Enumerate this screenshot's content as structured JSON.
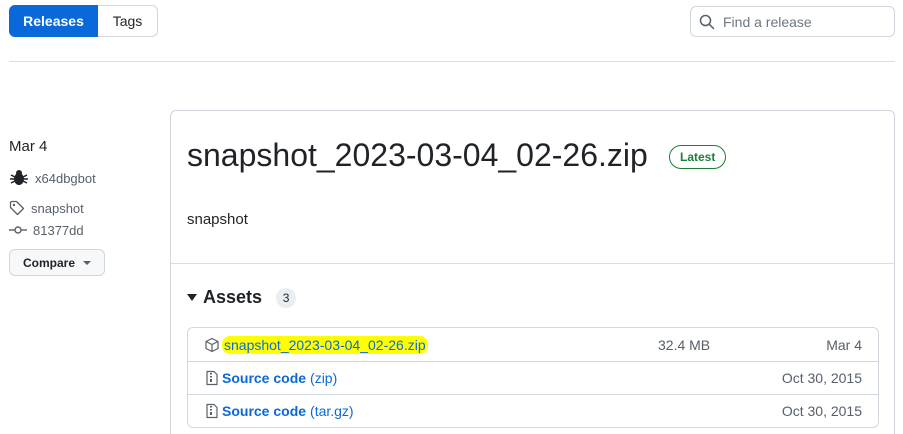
{
  "tabs": {
    "releases": "Releases",
    "tags": "Tags"
  },
  "search": {
    "placeholder": "Find a release"
  },
  "meta": {
    "date": "Mar 4",
    "author": "x64dbgbot",
    "tag": "snapshot",
    "commit": "81377dd",
    "compare_label": "Compare"
  },
  "release": {
    "title": "snapshot_2023-03-04_02-26.zip",
    "badge": "Latest",
    "body": "snapshot"
  },
  "assets": {
    "label": "Assets",
    "count": "3",
    "items": [
      {
        "name": "snapshot_2023-03-04_02-26.zip",
        "size": "32.4 MB",
        "date": "Mar 4"
      },
      {
        "name": "Source code",
        "ext": "(zip)",
        "size": "",
        "date": "Oct 30, 2015"
      },
      {
        "name": "Source code",
        "ext": "(tar.gz)",
        "size": "",
        "date": "Oct 30, 2015"
      }
    ]
  },
  "colors": {
    "accent": "#0969da",
    "latest_green": "#1a7f37",
    "highlight": "#ffff00"
  }
}
